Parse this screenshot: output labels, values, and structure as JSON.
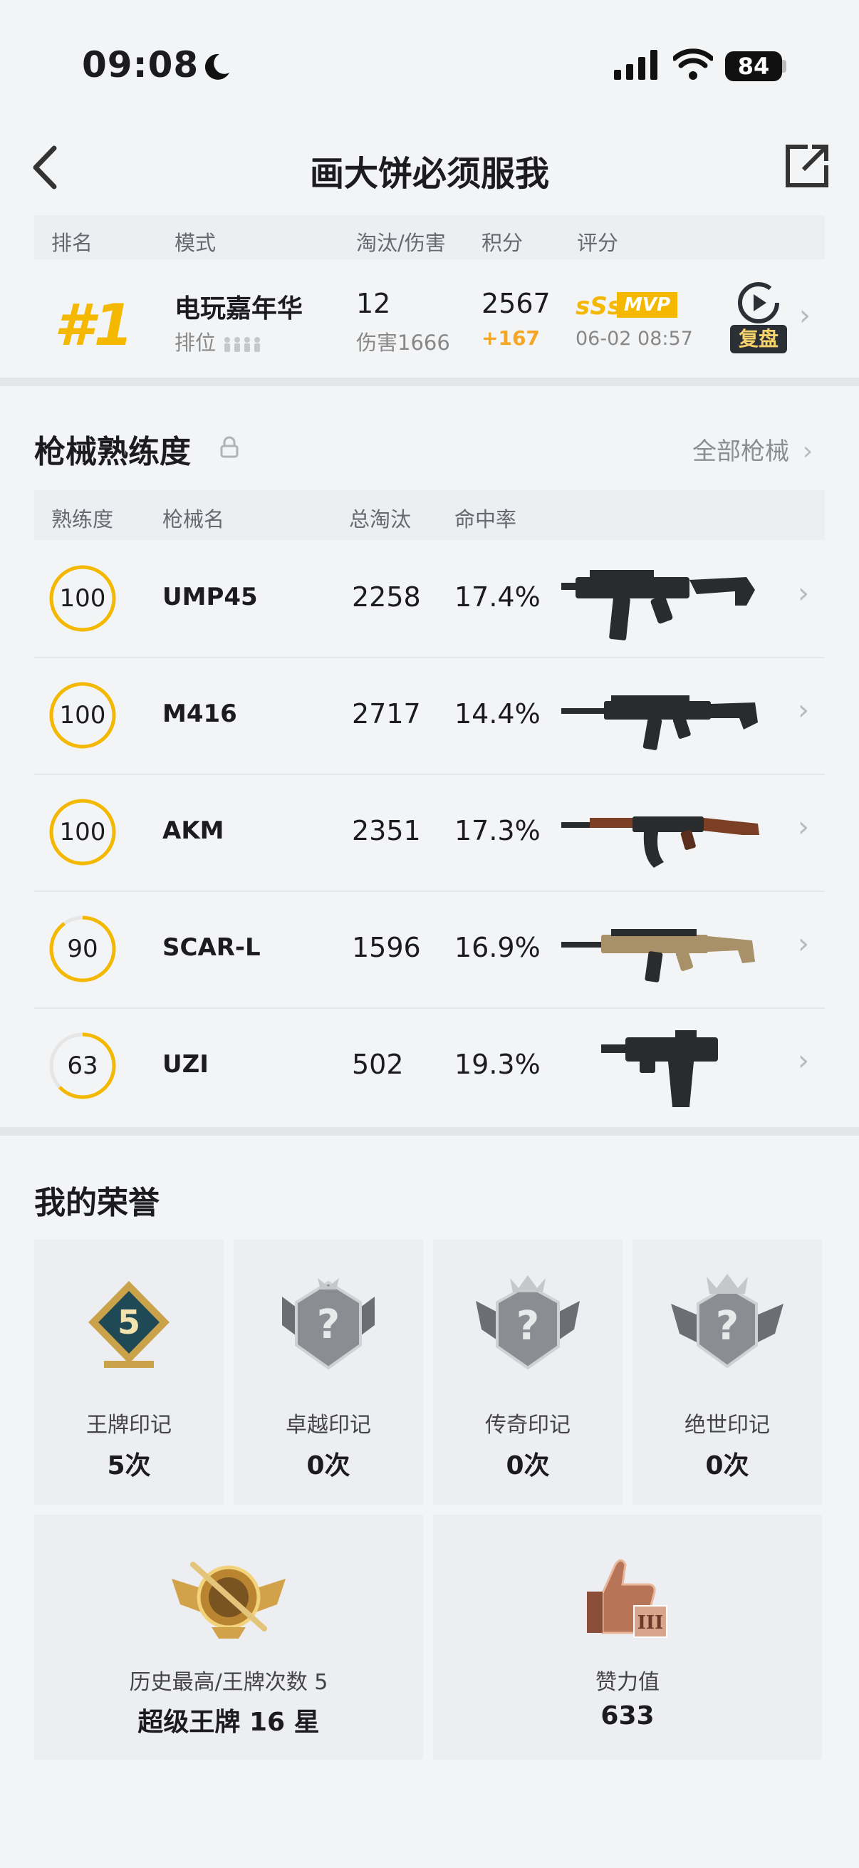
{
  "status_bar": {
    "time": "09:08",
    "battery": "84"
  },
  "nav": {
    "title": "画大饼必须服我"
  },
  "summary": {
    "headers": [
      "排名",
      "模式",
      "淘汰/伤害",
      "积分",
      "评分"
    ],
    "rank": "#1",
    "mode": "电玩嘉年华",
    "mode_sub": "排位",
    "kills": "12",
    "damage": "伤害1666",
    "score": "2567",
    "score_change": "+167",
    "grade": "sSs",
    "mvp": "MVP",
    "datetime": "06-02 08:57",
    "replay_label": "复盘"
  },
  "weapons": {
    "title": "枪械熟练度",
    "all_link": "全部枪械",
    "headers": [
      "熟练度",
      "枪械名",
      "总淘汰",
      "命中率"
    ],
    "rows": [
      {
        "mastery": "100",
        "name": "UMP45",
        "kills": "2258",
        "hit_rate": "17.4%",
        "progress": 1.0
      },
      {
        "mastery": "100",
        "name": "M416",
        "kills": "2717",
        "hit_rate": "14.4%",
        "progress": 1.0
      },
      {
        "mastery": "100",
        "name": "AKM",
        "kills": "2351",
        "hit_rate": "17.3%",
        "progress": 1.0
      },
      {
        "mastery": "90",
        "name": "SCAR-L",
        "kills": "1596",
        "hit_rate": "16.9%",
        "progress": 0.9
      },
      {
        "mastery": "63",
        "name": "UZI",
        "kills": "502",
        "hit_rate": "19.3%",
        "progress": 0.63
      }
    ]
  },
  "honors": {
    "title": "我的荣誉",
    "marks": [
      {
        "label": "王牌印记",
        "value": "5次",
        "badge": "5"
      },
      {
        "label": "卓越印记",
        "value": "0次"
      },
      {
        "label": "传奇印记",
        "value": "0次"
      },
      {
        "label": "绝世印记",
        "value": "0次"
      }
    ],
    "best": {
      "label": "历史最高/王牌次数 5",
      "value": "超级王牌 16 星"
    },
    "likes": {
      "label": "赞力值",
      "value": "633"
    }
  },
  "colors": {
    "accent": "#f5b800",
    "ring_track": "#e6e6e6"
  }
}
